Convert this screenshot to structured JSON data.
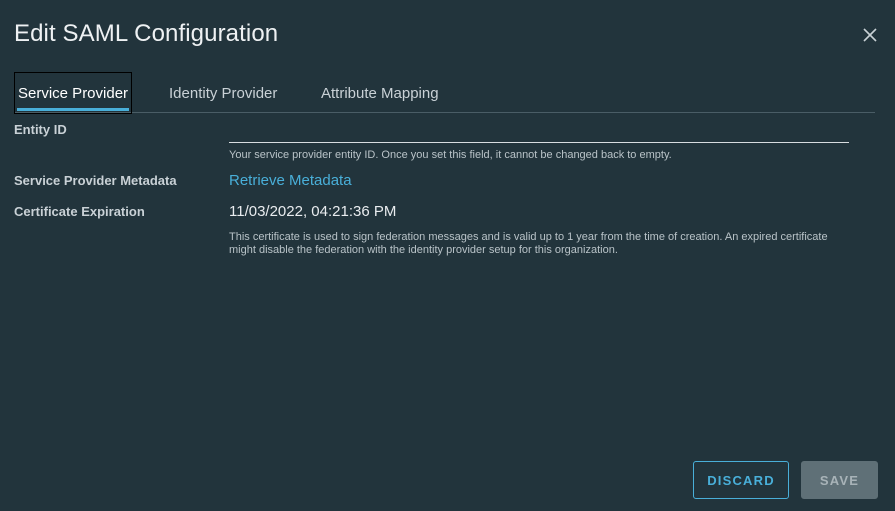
{
  "dialog": {
    "title": "Edit SAML Configuration",
    "close_icon": "close-icon"
  },
  "tabs": [
    {
      "label": "Service Provider",
      "active": true
    },
    {
      "label": "Identity Provider",
      "active": false
    },
    {
      "label": "Attribute Mapping",
      "active": false
    }
  ],
  "service_provider": {
    "entity_id": {
      "label": "Entity ID",
      "value": "",
      "helper": "Your service provider entity ID. Once you set this field, it cannot be changed back to empty."
    },
    "metadata": {
      "label": "Service Provider Metadata",
      "link_text": "Retrieve Metadata"
    },
    "certificate": {
      "label": "Certificate Expiration",
      "value": "11/03/2022, 04:21:36 PM",
      "helper": "This certificate is used to sign federation messages and is valid up to 1 year from the time of creation. An expired certificate might disable the federation with the identity provider setup for this organization."
    }
  },
  "footer": {
    "discard_label": "DISCARD",
    "save_label": "SAVE"
  },
  "colors": {
    "background": "#22343c",
    "accent": "#49afd9",
    "disabled_button": "#5f7077"
  }
}
